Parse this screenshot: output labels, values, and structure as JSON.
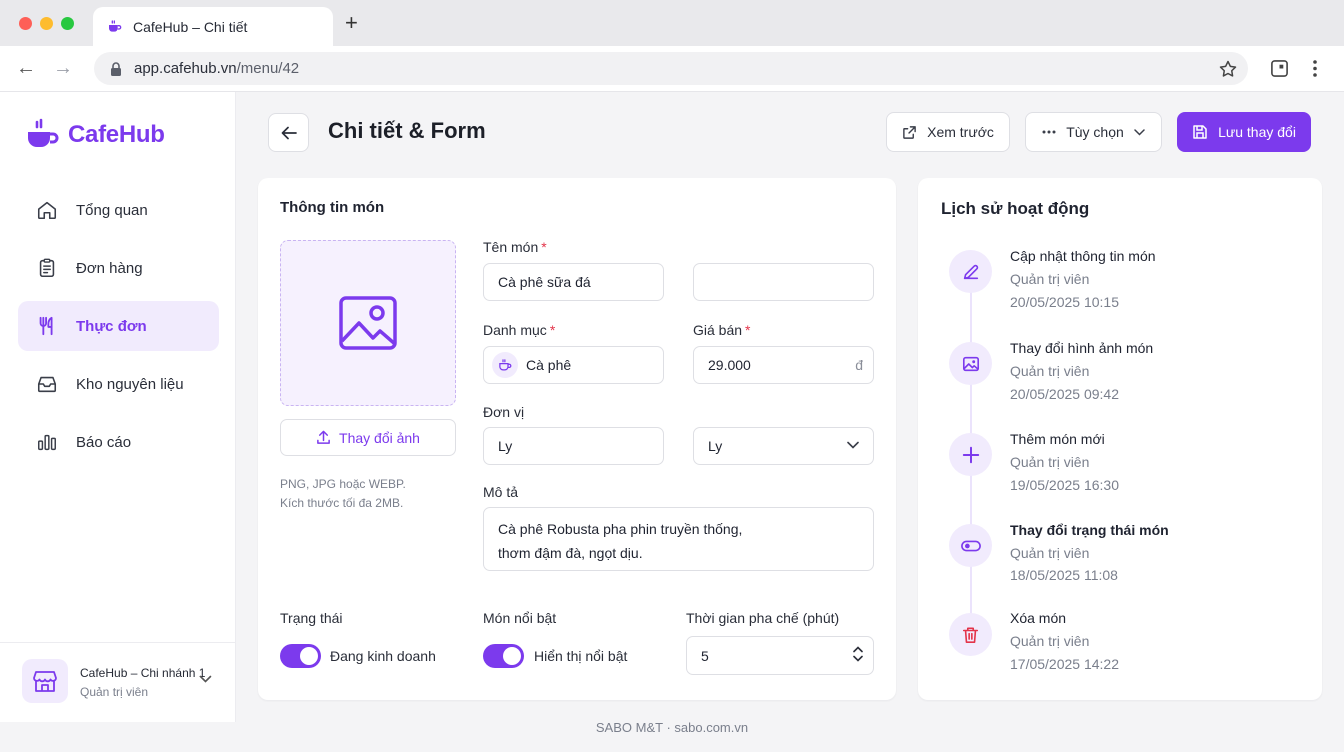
{
  "browser": {
    "tab_title": "CafeHub – Chi tiết",
    "new_tab": "+",
    "url_host": "app.cafehub.vn",
    "url_path": "/menu/42"
  },
  "sidebar": {
    "brand": "CafeHub",
    "items": [
      {
        "label": "Tổng quan",
        "icon": "home-icon"
      },
      {
        "label": "Đơn hàng",
        "icon": "clipboard-icon"
      },
      {
        "label": "Thực đơn",
        "icon": "utensils-icon",
        "active": true
      },
      {
        "label": "Kho nguyên liệu",
        "icon": "inbox-icon"
      },
      {
        "label": "Báo cáo",
        "icon": "bar-chart-icon"
      }
    ],
    "branch": {
      "name": "CafeHub – Chi nhánh 1",
      "role": "Quản trị viên"
    }
  },
  "header": {
    "title": "Chi tiết & Form",
    "preview_label": "Xem trước",
    "options_label": "Tùy chọn",
    "save_label": "Lưu thay đổi"
  },
  "form": {
    "section_title": "Thông tin món",
    "change_image_label": "Thay đổi ảnh",
    "image_hint_1": "PNG, JPG hoặc WEBP.",
    "image_hint_2": "Kích thước tối đa 2MB.",
    "name_label": "Tên món",
    "name_value": "Cà phê sữa đá",
    "extra_value": "",
    "category_label": "Danh mục",
    "category_value": "Cà phê",
    "price_label": "Giá bán",
    "price_value": "29.000",
    "price_suffix": "đ",
    "unit_label": "Đơn vị",
    "unit_value": "Ly",
    "unit_select_value": "Ly",
    "desc_label": "Mô tả",
    "desc_line_1": "Cà phê Robusta pha phin truyền thống,",
    "desc_line_2": "thơm đậm đà, ngọt dịu.",
    "required_mark": "*",
    "status_label": "Trạng thái",
    "status_value": "Đang kinh doanh",
    "status_on": true,
    "featured_label": "Món nổi bật",
    "featured_value": "Hiển thị nổi bật",
    "featured_on": true,
    "brew_label": "Thời gian pha chế (phút)",
    "brew_value": "5"
  },
  "history": {
    "title": "Lịch sử hoạt động",
    "items": [
      {
        "title": "Cập nhật thông tin món",
        "user": "Quản trị viên",
        "time": "20/05/2025 10:15",
        "icon": "pencil-icon"
      },
      {
        "title": "Thay đổi hình ảnh món",
        "user": "Quản trị viên",
        "time": "20/05/2025 09:42",
        "icon": "image-icon"
      },
      {
        "title": "Thêm món mới",
        "user": "Quản trị viên",
        "time": "19/05/2025 16:30",
        "icon": "plus-icon"
      },
      {
        "title": "Thay đổi trạng thái món",
        "user": "Quản trị viên",
        "time": "18/05/2025 11:08",
        "icon": "toggle-icon"
      },
      {
        "title": "Xóa món",
        "user": "Quản trị viên",
        "time": "17/05/2025 14:22",
        "icon": "trash-icon"
      }
    ]
  },
  "footer": "SABO M&T · sabo.com.vn",
  "colors": {
    "accent": "#7c3aed",
    "accent_soft": "#f1ebfd",
    "danger": "#e3344a"
  }
}
